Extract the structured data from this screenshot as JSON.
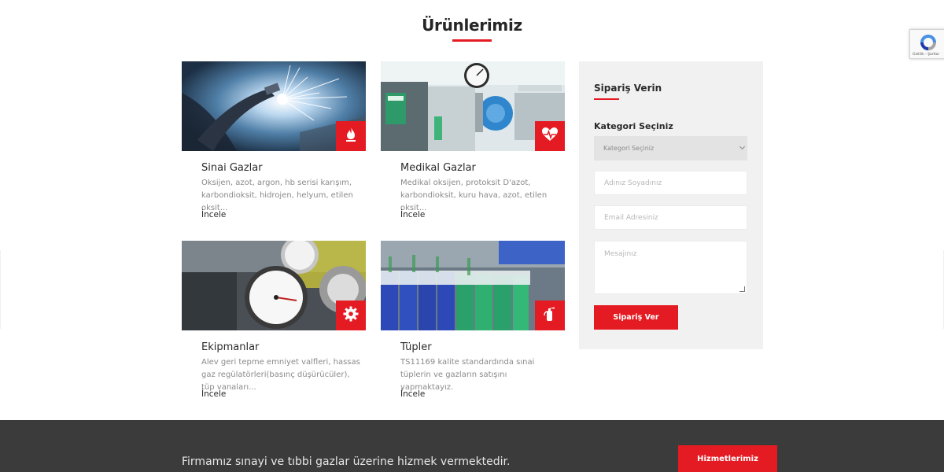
{
  "section": {
    "title": "Ürünlerimiz"
  },
  "cards": [
    {
      "title": "Sinai Gazlar",
      "desc": "Oksijen, azot, argon, hb serisi karışım, karbondioksit, hidrojen, helyum, etilen oksit...",
      "link": "İncele",
      "icon": "flame-icon"
    },
    {
      "title": "Medikal Gazlar",
      "desc": "Medikal oksijen, protoksit D'azot, karbondioksit, kuru hava, azot, etilen oksit...",
      "link": "İncele",
      "icon": "heartbeat-icon"
    },
    {
      "title": "Ekipmanlar",
      "desc": "Alev geri tepme emniyet valfleri, hassas gaz regülatörleri(basınç düşürücüler), tüp vanaları...",
      "link": "İncele",
      "icon": "gear-icon"
    },
    {
      "title": "Tüpler",
      "desc": "TS11169 kalite standardında sınai tüplerin ve gazların satışını yapmaktayız.",
      "link": "İncele",
      "icon": "fire-extinguisher-icon"
    }
  ],
  "order_form": {
    "title": "Sipariş Verin",
    "category_label": "Kategori Seçiniz",
    "category_selected": "Kategori Seçiniz",
    "name_placeholder": "Adınız Soyadınız",
    "email_placeholder": "Email Adresiniz",
    "message_placeholder": "Mesajınız",
    "submit_label": "Sipariş Ver"
  },
  "recaptcha": {
    "terms": "Gizlilik - Şartlar"
  },
  "footer": {
    "text": "Firmamız sınayi ve tıbbi gazlar üzerine hizmek vermektedir.",
    "button_label": "Hizmetlerimiz"
  },
  "colors": {
    "accent": "#e41b23",
    "sidebar_bg": "#f1f1f1",
    "footer_bg": "#3b3b3b"
  }
}
